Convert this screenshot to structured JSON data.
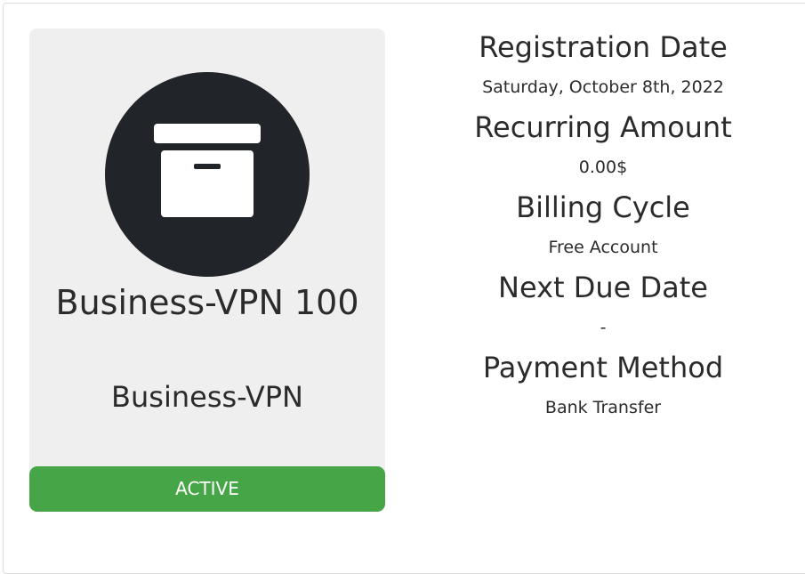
{
  "product": {
    "name": "Business-VPN 100",
    "group": "Business-VPN",
    "status": "ACTIVE",
    "icon": "archive-box-icon"
  },
  "details": [
    {
      "heading": "Registration Date",
      "value": "Saturday, October 8th, 2022"
    },
    {
      "heading": "Recurring Amount",
      "value": "0.00$"
    },
    {
      "heading": "Billing Cycle",
      "value": "Free Account"
    },
    {
      "heading": "Next Due Date",
      "value": "-"
    },
    {
      "heading": "Payment Method",
      "value": "Bank Transfer"
    }
  ],
  "colors": {
    "status_active": "#46a546",
    "icon_background": "#212529",
    "card_background": "#efefef"
  }
}
